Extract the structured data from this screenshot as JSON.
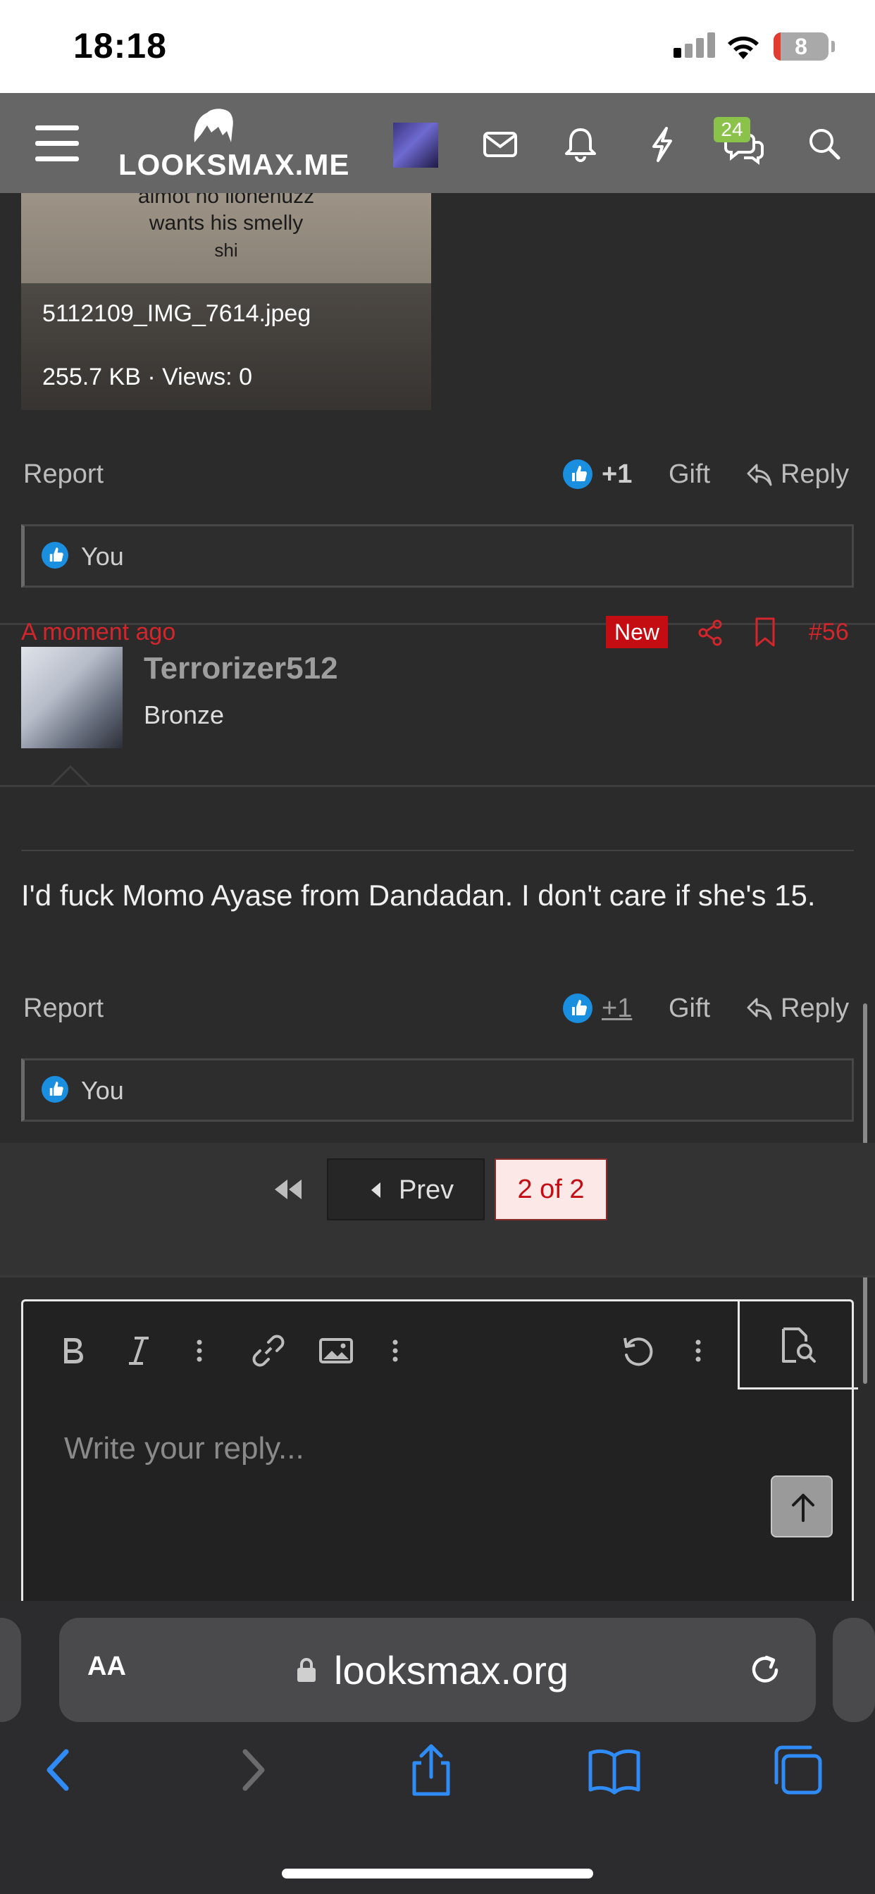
{
  "status_bar": {
    "time": "18:18",
    "battery_level": "8",
    "battery_color": "#e23b30"
  },
  "header": {
    "logo_text": "LOOKSMAX.ME",
    "chat_badge": "24",
    "icons": [
      "menu-icon",
      "avatar",
      "mail-icon",
      "bell-icon",
      "bolt-icon",
      "chat-icon",
      "search-icon"
    ],
    "badge_color": "#8bc34a",
    "background": "#666666"
  },
  "attachment": {
    "overlay_text_lines": [
      "almot no lionehuzz",
      "wants his smelly",
      "shi"
    ],
    "filename": "5112109_IMG_7614.jpeg",
    "meta": "255.7 KB · Views: 0"
  },
  "post1_actions": {
    "report": "Report",
    "like_count": "+1",
    "gift": "Gift",
    "reply": "Reply"
  },
  "post1_reactions": {
    "text": "You"
  },
  "post2": {
    "username": "Terrorizer512",
    "user_title": "Bronze",
    "time": "A moment ago",
    "new_badge": "New",
    "post_number": "#56",
    "body": "I'd fuck Momo Ayase from Dandadan. I don't care if she's 15.",
    "accent_color": "#d2262c"
  },
  "post2_actions": {
    "report": "Report",
    "like_count": "+1",
    "gift": "Gift",
    "reply": "Reply"
  },
  "post2_reactions": {
    "text": "You"
  },
  "pagination": {
    "prev_label": "Prev",
    "current": "2 of 2"
  },
  "editor": {
    "placeholder": "Write your reply...",
    "toolbar_icons": [
      "bold-icon",
      "italic-icon",
      "more-icon",
      "link-icon",
      "image-icon",
      "more-icon",
      "undo-icon",
      "more-icon",
      "preview-icon"
    ]
  },
  "browser": {
    "aa_label": "AA",
    "url": "looksmax.org"
  }
}
